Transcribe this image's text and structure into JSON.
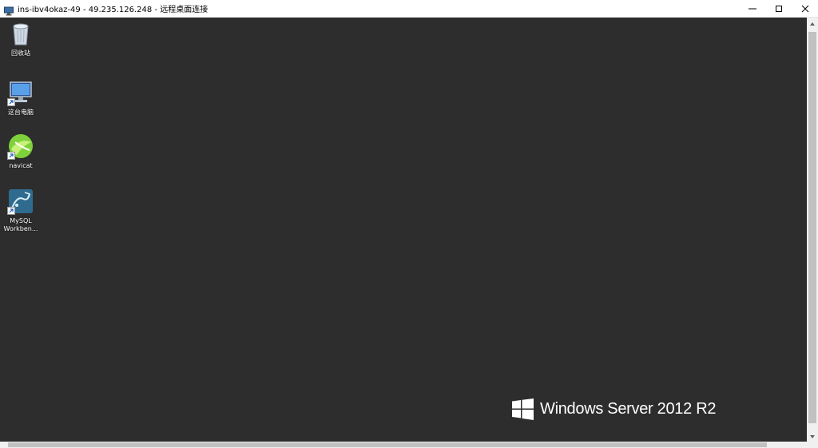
{
  "window": {
    "title": "ins-ibv4okaz-49 - 49.235.126.248 - 远程桌面连接",
    "app_icon": "remote-desktop-icon",
    "controls": [
      "minimize-icon",
      "maximize-icon",
      "close-icon"
    ]
  },
  "desktop": {
    "background_color": "#2d2d2d",
    "icons": [
      {
        "label": "回收站",
        "icon": "recycle-bin-icon",
        "shortcut": false
      },
      {
        "label": "这台电脑",
        "icon": "computer-icon",
        "shortcut": true
      },
      {
        "label": "navicat",
        "icon": "navicat-icon",
        "shortcut": true
      },
      {
        "label": "MySQL Workben...",
        "icon": "mysql-workbench-icon",
        "shortcut": true
      }
    ],
    "branding": {
      "text": "Windows Server 2012 R2",
      "icon": "windows-logo-icon"
    }
  }
}
